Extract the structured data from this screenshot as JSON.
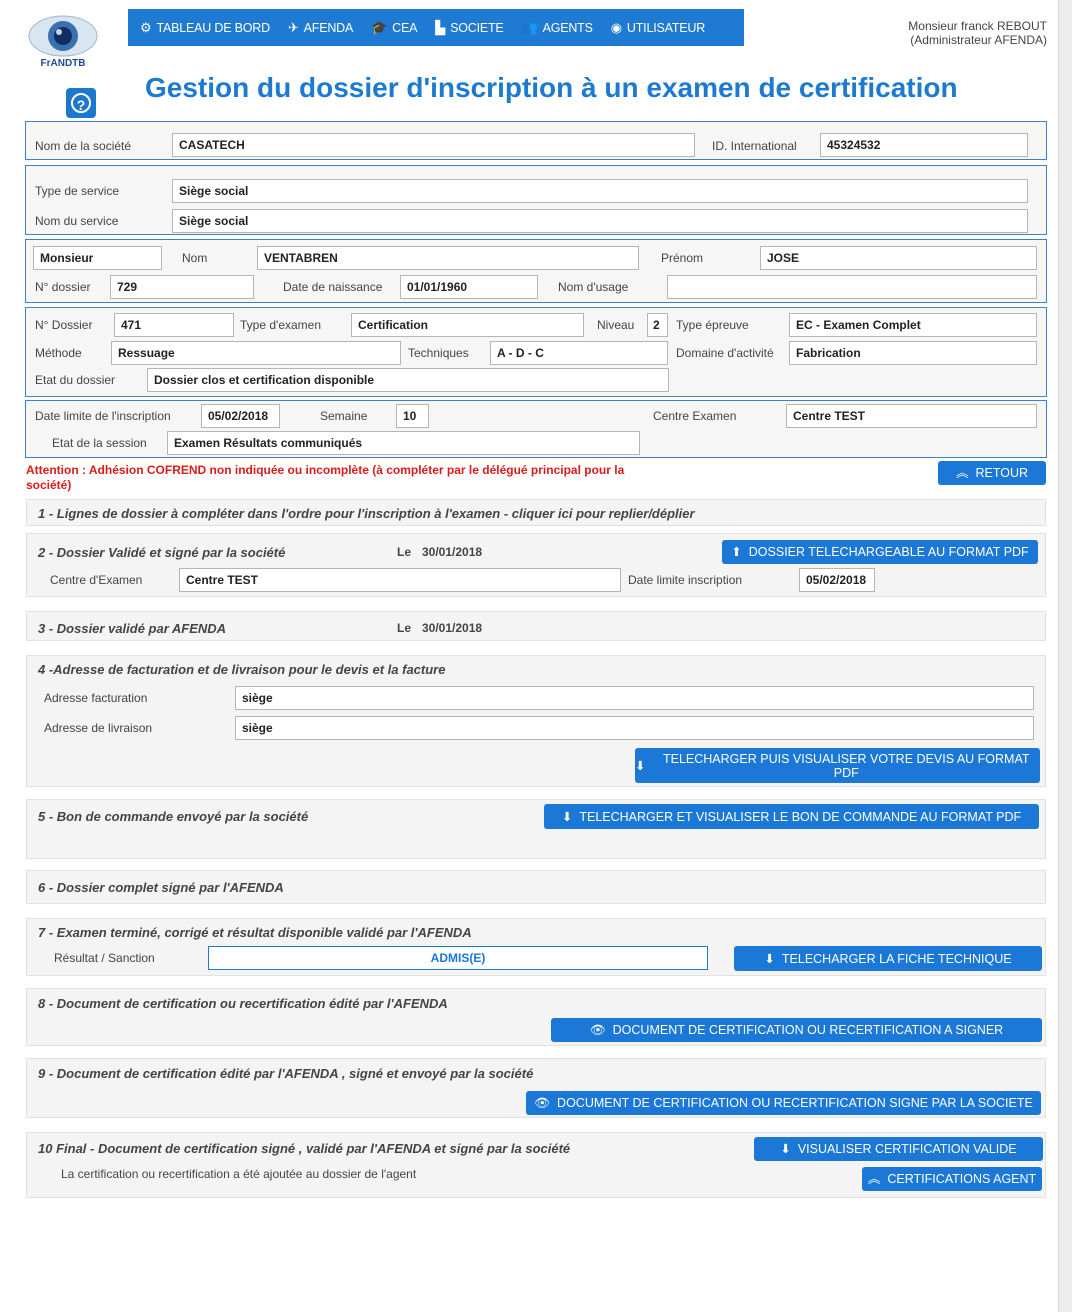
{
  "logo": {
    "text": "FrANDTB"
  },
  "nav": [
    {
      "icon": "dashboard-icon",
      "glyph": "⚙",
      "label": "TABLEAU DE BORD"
    },
    {
      "icon": "plane-icon",
      "glyph": "✈",
      "label": "AFENDA"
    },
    {
      "icon": "graduation-cap-icon",
      "glyph": "🎓",
      "label": "CEA"
    },
    {
      "icon": "chart-icon",
      "glyph": "▙",
      "label": "SOCIETE"
    },
    {
      "icon": "users-icon",
      "glyph": "👥",
      "label": "AGENTS"
    },
    {
      "icon": "user-circle-icon",
      "glyph": "◉",
      "label": "UTILISATEUR"
    }
  ],
  "user": {
    "name": "Monsieur franck REBOUT",
    "role": "(Administrateur AFENDA)"
  },
  "page_title": "Gestion du dossier d'inscription à un examen de certification",
  "company": {
    "name_label": "Nom de la société",
    "name": "CASATECH",
    "id_label": "ID. International",
    "id": "45324532"
  },
  "service": {
    "type_label": "Type de service",
    "type": "Siège social",
    "name_label": "Nom du service",
    "name": "Siège social"
  },
  "person": {
    "civility": "Monsieur",
    "nom_label": "Nom",
    "nom": "VENTABREN",
    "prenom_label": "Prénom",
    "prenom": "JOSE",
    "dossier_label": "N° dossier",
    "dossier": "729",
    "dob_label": "Date de naissance",
    "dob": "01/01/1960",
    "usage_label": "Nom d'usage",
    "usage": ""
  },
  "exam": {
    "dossier_label": "N° Dossier",
    "dossier": "471",
    "type_label": "Type d'examen",
    "type": "Certification",
    "niveau_label": "Niveau",
    "niveau": "2",
    "epreuve_label": "Type épreuve",
    "epreuve": "EC - Examen Complet",
    "methode_label": "Méthode",
    "methode": "Ressuage",
    "tech_label": "Techniques",
    "tech": "A - D - C",
    "domaine_label": "Domaine d'activité",
    "domaine": "Fabrication",
    "etat_label": "Etat du dossier",
    "etat": "Dossier clos et certification disponible"
  },
  "session": {
    "limit_label": "Date limite de l'inscription",
    "limit": "05/02/2018",
    "week_label": "Semaine",
    "week": "10",
    "centre_label": "Centre Examen",
    "centre": "Centre TEST",
    "state_label": "Etat de la session",
    "state": "Examen Résultats communiqués"
  },
  "warning": "Attention : Adhésion COFREND non indiquée ou incomplète (à compléter par le délégué principal pour la société)",
  "retour": "RETOUR",
  "s1": {
    "title": "1 - Lignes de dossier à compléter dans l'ordre pour l'inscription à l'examen - cliquer ici pour replier/déplier"
  },
  "s2": {
    "title": "2 - Dossier Validé et signé par la société",
    "le": "Le",
    "date": "30/01/2018",
    "btn": "DOSSIER TELECHARGEABLE AU FORMAT PDF",
    "centre_label": "Centre d'Examen",
    "centre": "Centre TEST",
    "limit_label": "Date limite inscription",
    "limit": "05/02/2018"
  },
  "s3": {
    "title": "3 - Dossier validé par AFENDA",
    "le": "Le",
    "date": "30/01/2018"
  },
  "s4": {
    "title": "4 -Adresse de facturation et de livraison pour le devis et la facture",
    "fact_label": "Adresse facturation",
    "fact": "siège",
    "liv_label": "Adresse de livraison",
    "liv": "siège",
    "btn": "TELECHARGER PUIS VISUALISER VOTRE DEVIS AU FORMAT PDF"
  },
  "s5": {
    "title": "5 - Bon de commande envoyé par la société",
    "btn": "TELECHARGER ET VISUALISER LE BON DE COMMANDE AU FORMAT PDF"
  },
  "s6": {
    "title": "6 - Dossier complet signé par l'AFENDA"
  },
  "s7": {
    "title": "7 - Examen terminé, corrigé et résultat disponible validé par l'AFENDA",
    "result_label": "Résultat / Sanction",
    "result": "ADMIS(E)",
    "btn": "TELECHARGER LA FICHE TECHNIQUE"
  },
  "s8": {
    "title": "8 - Document de certification ou recertification édité par l'AFENDA",
    "btn": "DOCUMENT DE CERTIFICATION OU RECERTIFICATION A SIGNER"
  },
  "s9": {
    "title": "9 - Document de certification édité par l'AFENDA , signé et envoyé par la société",
    "btn": "DOCUMENT DE CERTIFICATION OU RECERTIFICATION SIGNE PAR LA SOCIETE"
  },
  "s10": {
    "title": "10 Final - Document de certification signé , validé par l'AFENDA et signé par la société",
    "note": "La certification ou recertification a été ajoutée au dossier de l'agent",
    "btn1": "VISUALISER CERTIFICATION VALIDE",
    "btn2": "CERTIFICATIONS AGENT"
  },
  "colors": {
    "primary": "#1b78d6",
    "title": "#1d7ad0",
    "warning": "#d81c1c",
    "border": "#3a82c4"
  }
}
